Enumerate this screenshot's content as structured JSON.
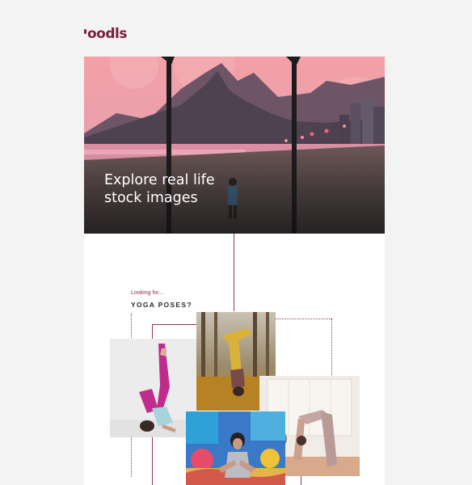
{
  "brand": {
    "logo_text": "oodls",
    "accent": "#7a1f3a"
  },
  "hero": {
    "title_line1": "Explore real life",
    "title_line2": "stock images",
    "image": "beach-sunset-mountain-photo"
  },
  "search_prompt": {
    "eyebrow": "Looking for...",
    "query": "YOGA POSES?"
  },
  "results": [
    {
      "image": "yoga-shoulder-stand-photo"
    },
    {
      "image": "yoga-forest-headstand-photo"
    },
    {
      "image": "yoga-forward-bend-photo"
    },
    {
      "image": "yoga-pose-mural-photo"
    }
  ]
}
